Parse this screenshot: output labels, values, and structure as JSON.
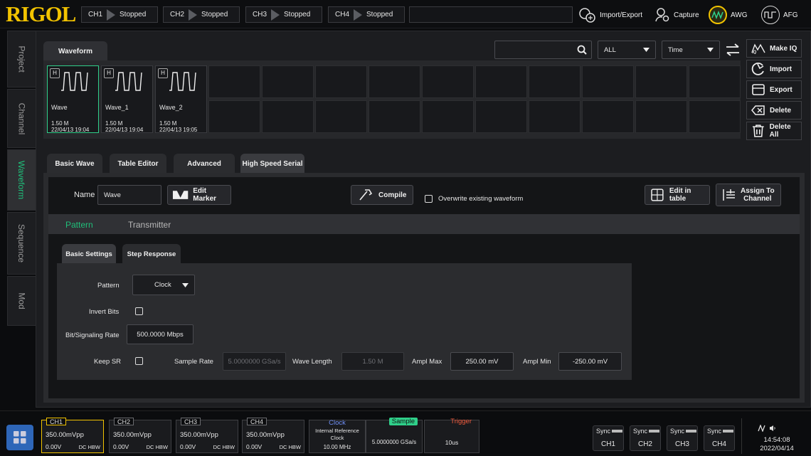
{
  "brand": "RIGOL",
  "channels_status": [
    {
      "name": "CH1",
      "status": "Stopped"
    },
    {
      "name": "CH2",
      "status": "Stopped"
    },
    {
      "name": "CH3",
      "status": "Stopped"
    },
    {
      "name": "CH4",
      "status": "Stopped"
    }
  ],
  "top_buttons": {
    "import_export": "Import/Export",
    "capture": "Capture",
    "awg": "AWG",
    "afg": "AFG"
  },
  "side_tabs": [
    "Project",
    "Channel",
    "Waveform",
    "Sequence",
    "Mod"
  ],
  "waveform_panel": {
    "tab": "Waveform",
    "filter": "ALL",
    "sort": "Time",
    "waveforms": [
      {
        "badge": "H",
        "name": "Wave",
        "size": "1.50 M",
        "date": "22/04/13 19:04"
      },
      {
        "badge": "H",
        "name": "Wave_1",
        "size": "1.50 M",
        "date": "22/04/13 19:04"
      },
      {
        "badge": "H",
        "name": "Wave_2",
        "size": "1.50 M",
        "date": "22/04/13 19:05"
      }
    ],
    "actions": {
      "make_iq": "Make IQ",
      "import": "Import",
      "export": "Export",
      "delete": "Delete",
      "delete_all": "Delete All"
    }
  },
  "editor": {
    "tabs": [
      "Basic Wave",
      "Table Editor",
      "Advanced",
      "High Speed Serial"
    ],
    "active_tab": "High Speed Serial",
    "name_label": "Name",
    "name_value": "Wave",
    "edit_marker": "Edit Marker",
    "compile": "Compile",
    "overwrite": "Overwrite existing waveform",
    "edit_in_table": "Edit in table",
    "assign_line1": "Assign To",
    "assign_line2": "Channel",
    "subtabs": [
      "Pattern",
      "Transmitter"
    ],
    "inner_tabs": [
      "Basic Settings",
      "Step Response"
    ],
    "pattern_label": "Pattern",
    "pattern_value": "Clock",
    "invert_bits": "Invert Bits",
    "bit_rate_label": "Bit/Signaling Rate",
    "bit_rate_value": "500.0000 Mbps",
    "keep_sr": "Keep SR",
    "sample_rate_label": "Sample Rate",
    "sample_rate_value": "5.0000000 GSa/s",
    "wave_length_label": "Wave Length",
    "wave_length_value": "1.50 M",
    "ampl_max_label": "Ampl Max",
    "ampl_max_value": "250.00 mV",
    "ampl_min_label": "Ampl Min",
    "ampl_min_value": "-250.00 mV"
  },
  "bottom_channels": [
    {
      "name": "CH1",
      "amp": "350.00mVpp",
      "offset": "0.00V",
      "mode": "DC HBW"
    },
    {
      "name": "CH2",
      "amp": "350.00mVpp",
      "offset": "0.00V",
      "mode": "DC HBW"
    },
    {
      "name": "CH3",
      "amp": "350.00mVpp",
      "offset": "0.00V",
      "mode": "DC HBW"
    },
    {
      "name": "CH4",
      "amp": "350.00mVpp",
      "offset": "0.00V",
      "mode": "DC HBW"
    }
  ],
  "clock": {
    "title": "Clock",
    "line1": "Internal Reference",
    "line2": "Clock",
    "freq": "10.00 MHz"
  },
  "sample": {
    "title": "Sample",
    "value": "5.0000000 GSa/s"
  },
  "trigger": {
    "title": "Trigger",
    "value": "10us"
  },
  "sync": [
    {
      "label": "Sync",
      "ch": "CH1"
    },
    {
      "label": "Sync",
      "ch": "CH2"
    },
    {
      "label": "Sync",
      "ch": "CH3"
    },
    {
      "label": "Sync",
      "ch": "CH4"
    }
  ],
  "time": "14:54:08",
  "date": "2022/04/14",
  "colors": {
    "accent": "#1fbf7a",
    "brand": "#f2c300",
    "clock_title": "#6f8ff5",
    "sample_title": "#2fd08a",
    "trigger_title": "#f05a3c"
  }
}
